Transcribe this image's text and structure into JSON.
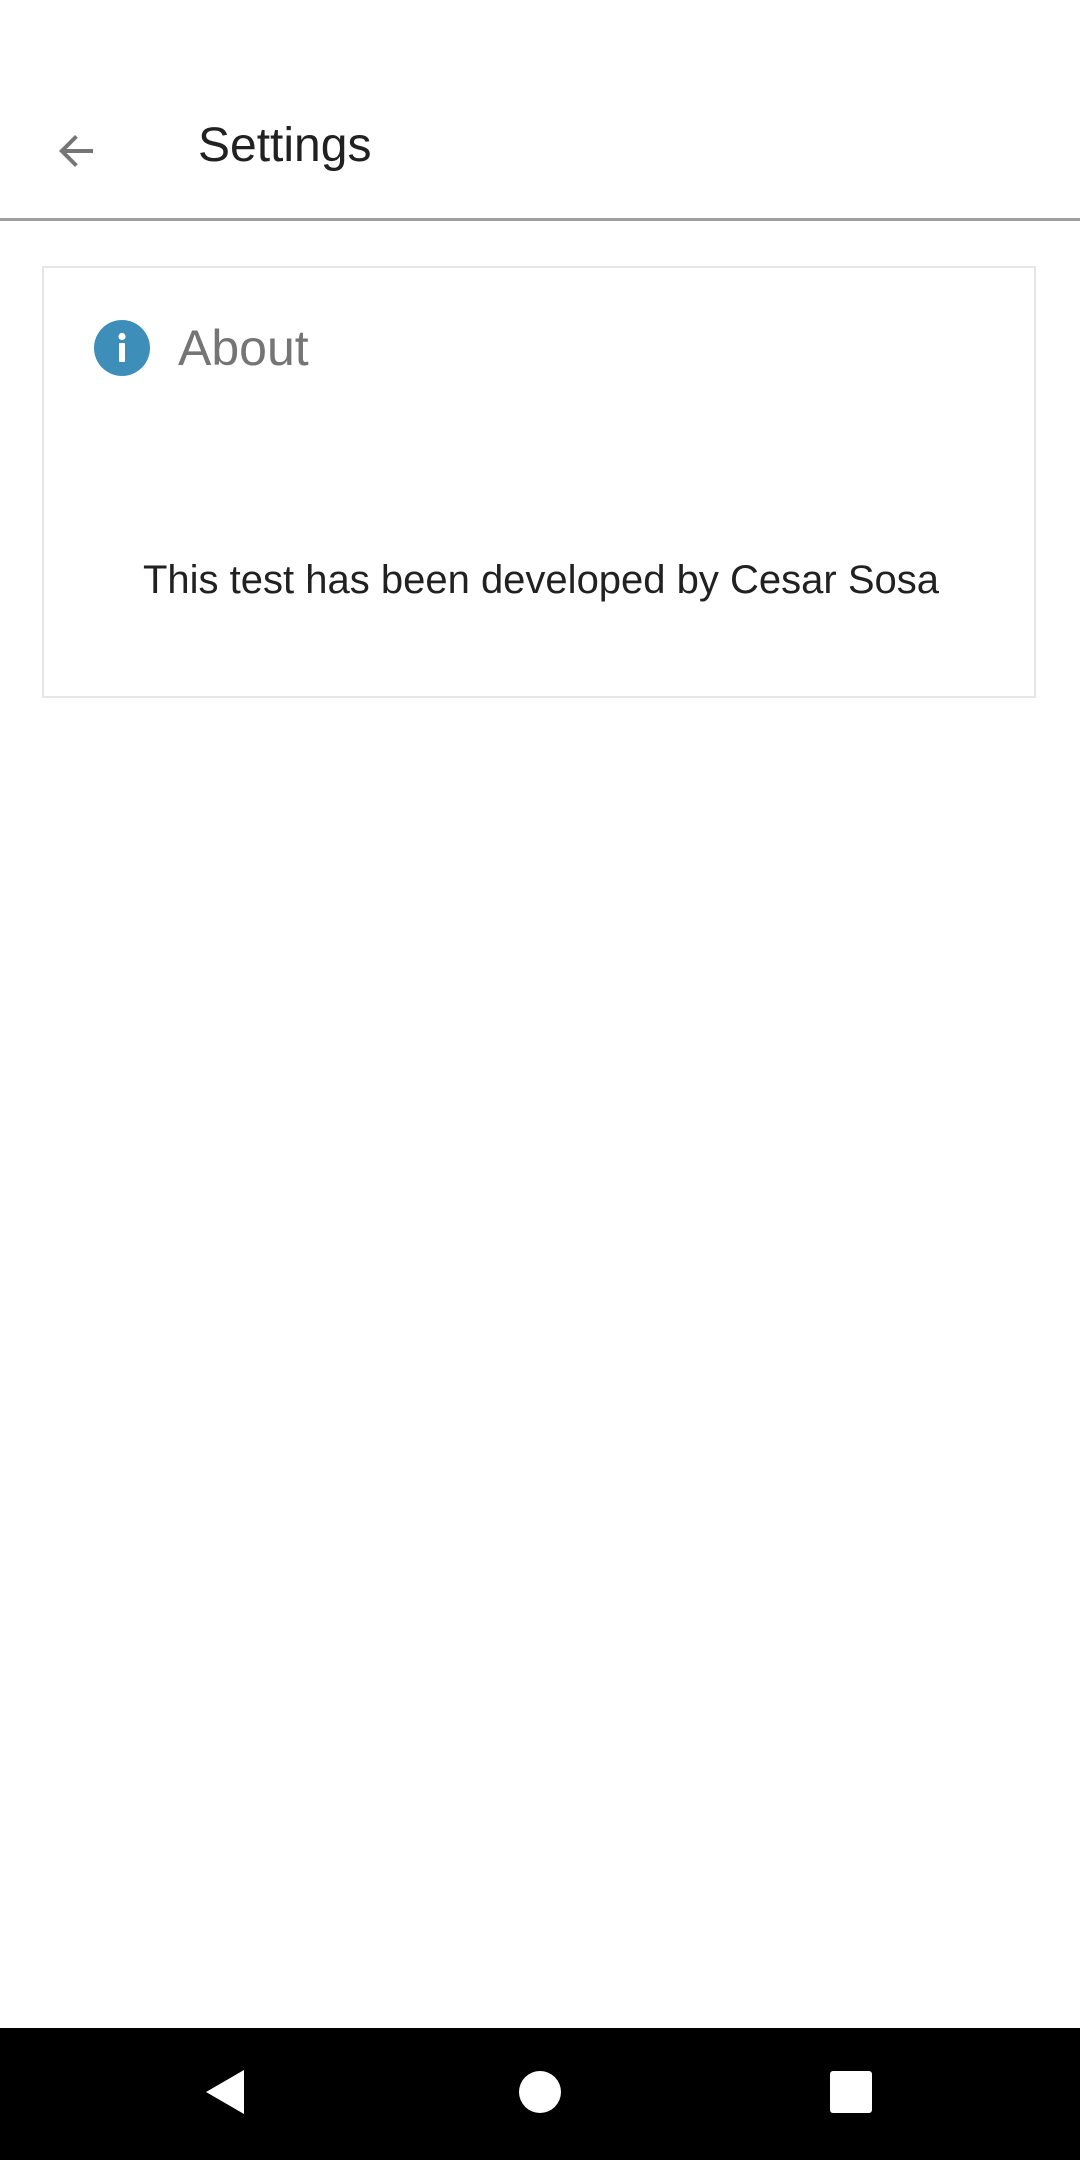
{
  "app_bar": {
    "title": "Settings",
    "back_icon": "arrow-left-icon"
  },
  "about_card": {
    "icon": "info-icon",
    "icon_glyph": "i",
    "title": "About",
    "text": "This test has been developed by Cesar Sosa"
  },
  "nav_bar": {
    "back_icon": "nav-back-icon",
    "home_icon": "nav-home-icon",
    "recents_icon": "nav-recents-icon"
  },
  "colors": {
    "accent": "#3d8fba",
    "title_text": "#212121",
    "secondary_text": "#757575",
    "divider": "#9e9e9e",
    "nav_background": "#000000"
  }
}
